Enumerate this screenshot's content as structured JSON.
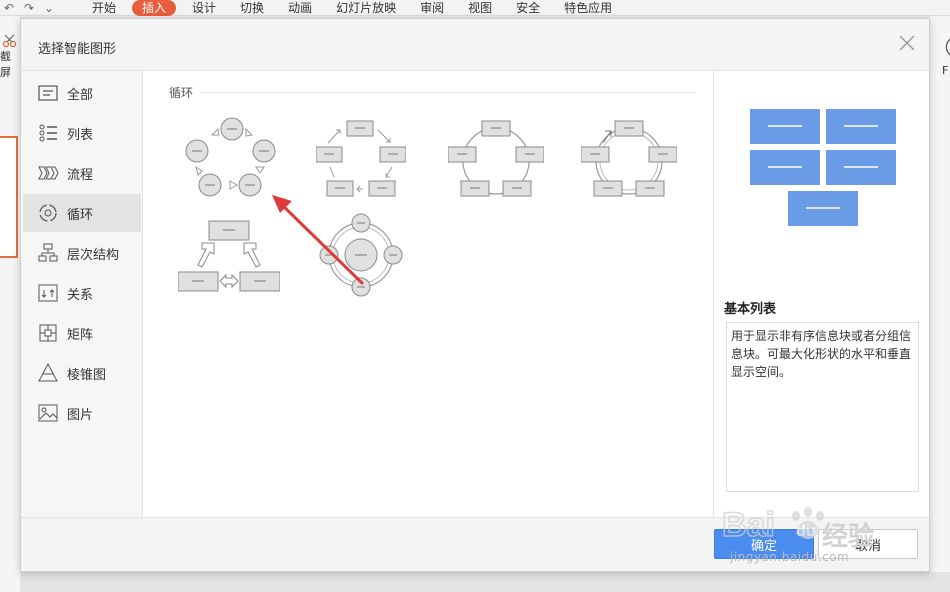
{
  "ribbon": {
    "tabs": [
      {
        "label": "开始",
        "active": false
      },
      {
        "label": "插入",
        "active": true
      },
      {
        "label": "设计",
        "active": false
      },
      {
        "label": "切换",
        "active": false
      },
      {
        "label": "动画",
        "active": false
      },
      {
        "label": "幻灯片放映",
        "active": false
      },
      {
        "label": "审阅",
        "active": false
      },
      {
        "label": "视图",
        "active": false
      },
      {
        "label": "安全",
        "active": false
      },
      {
        "label": "特色应用",
        "active": false
      }
    ],
    "left_tool_label": "截屏",
    "right_tool_label": "F"
  },
  "dialog": {
    "title": "选择智能图形",
    "categories": [
      {
        "label": "全部",
        "icon": "all-icon"
      },
      {
        "label": "列表",
        "icon": "list-icon"
      },
      {
        "label": "流程",
        "icon": "process-icon"
      },
      {
        "label": "循环",
        "icon": "cycle-icon",
        "active": true
      },
      {
        "label": "层次结构",
        "icon": "hierarchy-icon"
      },
      {
        "label": "关系",
        "icon": "relationship-icon"
      },
      {
        "label": "矩阵",
        "icon": "matrix-icon"
      },
      {
        "label": "棱锥图",
        "icon": "pyramid-icon"
      },
      {
        "label": "图片",
        "icon": "picture-icon"
      }
    ],
    "section_label": "循环",
    "preview": {
      "title": "基本列表",
      "description": "用于显示非有序信息块或者分组信息块。可最大化形状的水平和垂直显示空间。",
      "accent": "#6a9be6"
    },
    "buttons": {
      "ok": "确定",
      "cancel": "取消"
    }
  },
  "watermark": {
    "brand": "Baidu经验",
    "url": "jingyan.baidu.com"
  },
  "colors": {
    "tab_active": "#e85d3b",
    "primary_button": "#4a8cf0",
    "annotation_arrow": "#e03a3a"
  }
}
